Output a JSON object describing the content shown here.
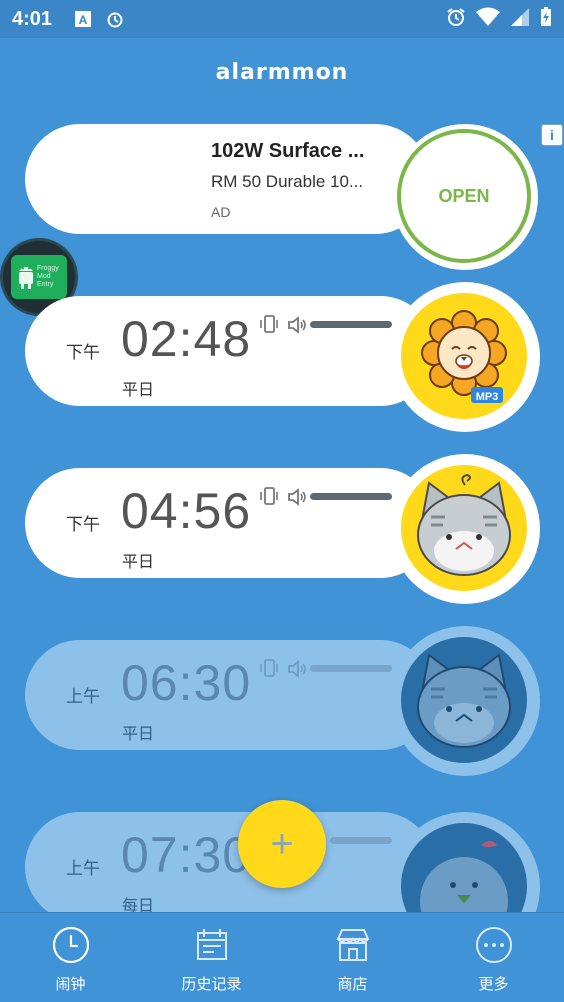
{
  "status_bar": {
    "time": "4:01",
    "icons": [
      "a-icon",
      "alarm-clock-icon",
      "alarm-clock-icon",
      "wifi-icon",
      "signal-icon",
      "battery-icon"
    ]
  },
  "header": {
    "logo": "alarmmon"
  },
  "ad": {
    "title": "102W Surface ...",
    "subtitle": "RM 50 Durable 10...",
    "tag": "AD",
    "open_label": "OPEN",
    "info_label": "i"
  },
  "floating_bubble": {
    "text": "Froggy Mod Entry"
  },
  "alarms": [
    {
      "ampm": "下午",
      "time": "02:48",
      "days": "平日",
      "enabled": true,
      "character": "lion",
      "badge": "MP3"
    },
    {
      "ampm": "下午",
      "time": "04:56",
      "days": "平日",
      "enabled": true,
      "character": "cat"
    },
    {
      "ampm": "上午",
      "time": "06:30",
      "days": "平日",
      "enabled": false,
      "character": "cat"
    },
    {
      "ampm": "上午",
      "time": "07:30",
      "days": "每日",
      "enabled": false,
      "character": "bird"
    }
  ],
  "fab": {
    "label": "+"
  },
  "bottom_nav": {
    "items": [
      {
        "label": "闹钟",
        "icon": "clock-icon"
      },
      {
        "label": "历史记录",
        "icon": "calendar-icon"
      },
      {
        "label": "商店",
        "icon": "store-icon"
      },
      {
        "label": "更多",
        "icon": "more-icon"
      }
    ]
  },
  "colors": {
    "background": "#3f93d6",
    "accent_yellow": "#ffd91a",
    "open_green": "#7ab648"
  }
}
